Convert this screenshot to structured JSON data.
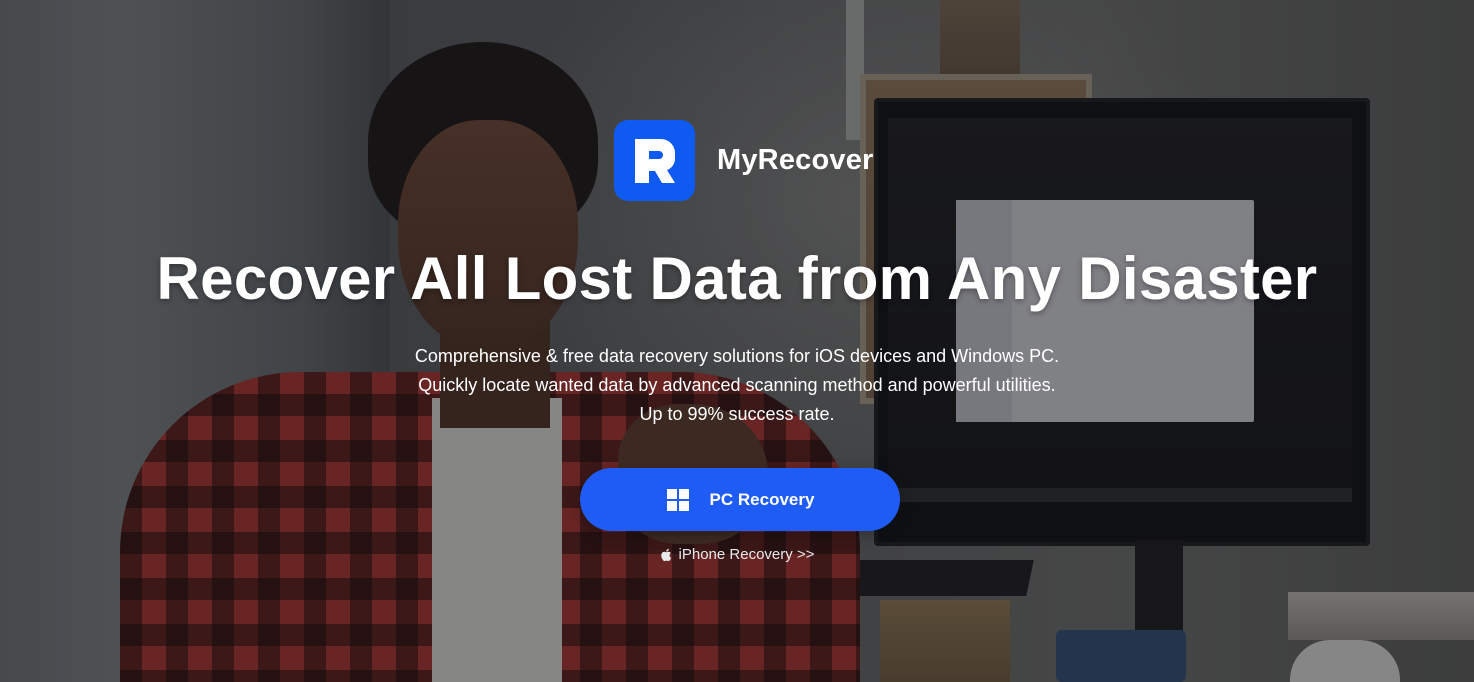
{
  "brand": {
    "name": "MyRecover",
    "logo_icon": "myrecover-logo-icon",
    "logo_color": "#0f5af0"
  },
  "hero": {
    "headline": "Recover All Lost Data from Any Disaster",
    "subtitle_lines": [
      "Comprehensive & free data recovery solutions for iOS devices and Windows PC.",
      "Quickly locate wanted data by advanced scanning method and powerful utilities.",
      "Up to 99% success rate."
    ]
  },
  "actions": {
    "pc_recovery": {
      "label": "PC Recovery",
      "icon": "windows-icon",
      "color": "#1f5cf5"
    },
    "iphone_recovery": {
      "label": "iPhone Recovery >>",
      "icon": "apple-icon"
    }
  }
}
